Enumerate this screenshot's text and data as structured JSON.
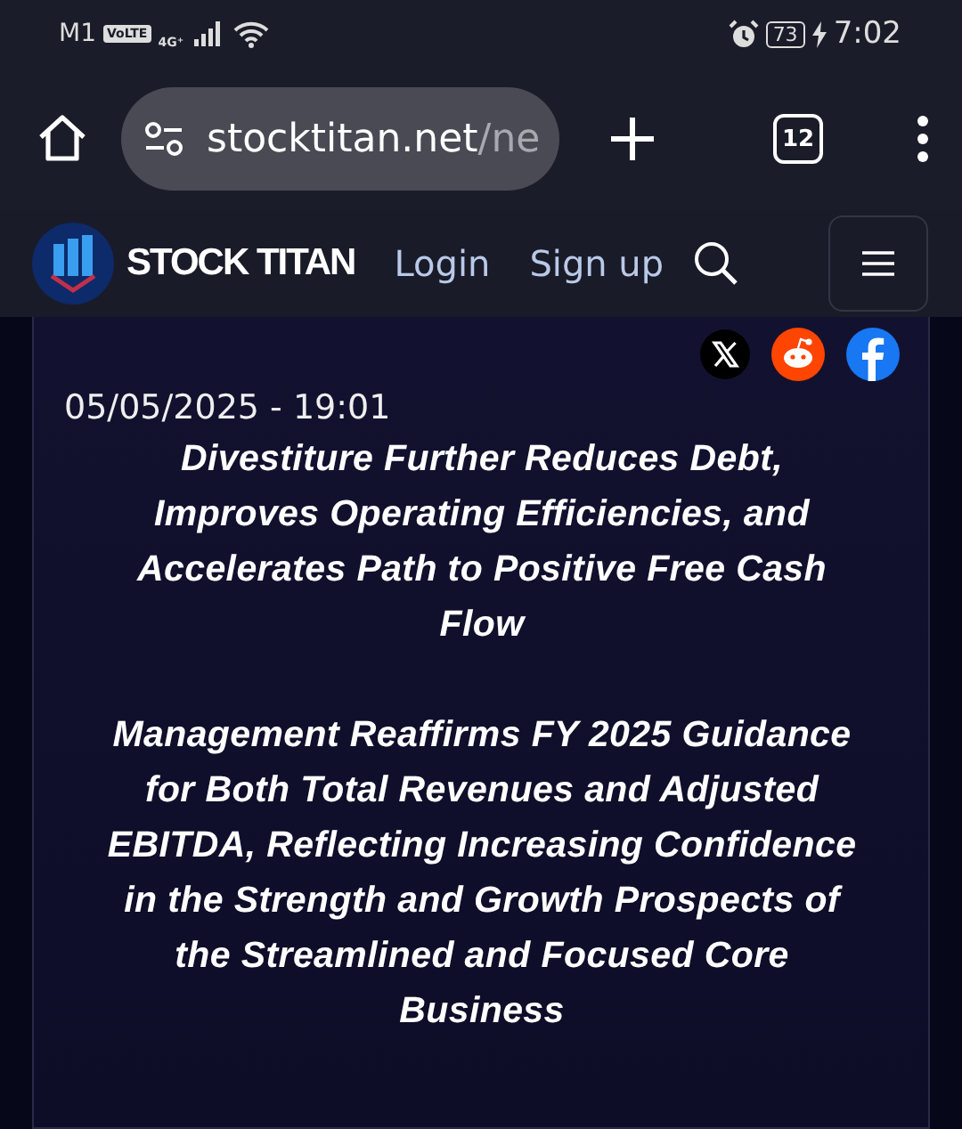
{
  "status_bar": {
    "carrier": "M1",
    "volte": "VoLTE",
    "network": "4G⁺",
    "battery": "73",
    "charging": true,
    "time": "7:02"
  },
  "browser": {
    "url_host": "stocktitan.net",
    "url_path": "/ne",
    "tab_count": "12"
  },
  "site_header": {
    "logo_text": "STOCK TITAN",
    "links": [
      "Login",
      "Sign up"
    ]
  },
  "article": {
    "date": "05/05/2025 - 19:01",
    "share": [
      {
        "kind": "x"
      },
      {
        "kind": "reddit"
      },
      {
        "kind": "facebook"
      }
    ],
    "paragraphs": [
      "Divestiture Further Reduces Debt, Improves Operating Efficiencies, and Accelerates Path to Positive Free Cash Flow",
      "Management Reaffirms FY 2025 Guidance for Both Total Revenues and Adjusted EBITDA, Reflecting Increasing Confidence in the Strength and Growth Prospects of the Streamlined and Focused Core Business"
    ]
  }
}
